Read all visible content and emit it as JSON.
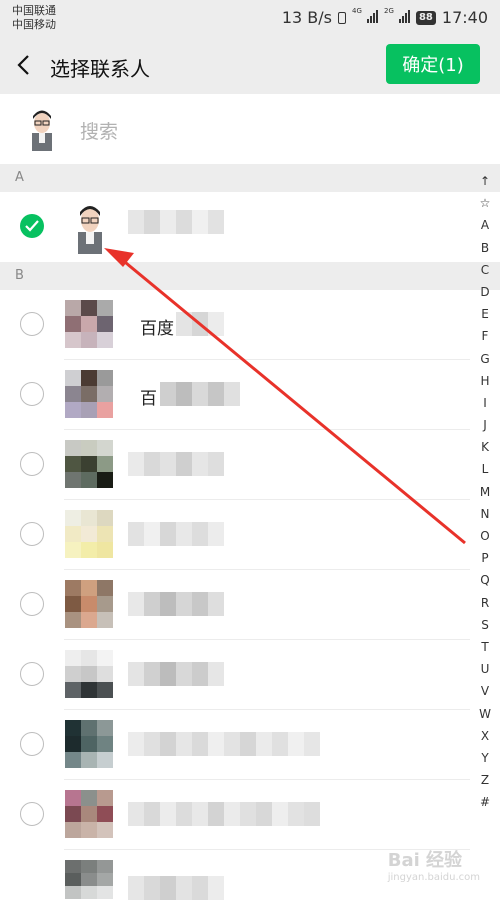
{
  "status": {
    "carrier1": "中国联通",
    "carrier2": "中国移动",
    "speed": "13 B/s",
    "net1": "4G",
    "net2": "2G",
    "battery": "88",
    "time": "17:40"
  },
  "header": {
    "title": "选择联系人",
    "confirm_label": "确定(1)"
  },
  "search": {
    "placeholder": "搜索"
  },
  "sections": [
    {
      "letter": "A"
    },
    {
      "letter": "B"
    }
  ],
  "contacts": [
    {
      "name_visible": "百度"
    },
    {
      "name_visible": "百"
    }
  ],
  "index_letters": [
    "↑",
    "☆",
    "A",
    "B",
    "C",
    "D",
    "E",
    "F",
    "G",
    "H",
    "I",
    "J",
    "K",
    "L",
    "M",
    "N",
    "O",
    "P",
    "Q",
    "R",
    "S",
    "T",
    "U",
    "V",
    "W",
    "X",
    "Y",
    "Z",
    "#"
  ],
  "watermark": {
    "brand": "Bai 经验",
    "url": "jingyan.baidu.com"
  },
  "colors": {
    "accent": "#07c160",
    "arrow": "#e8322a"
  }
}
